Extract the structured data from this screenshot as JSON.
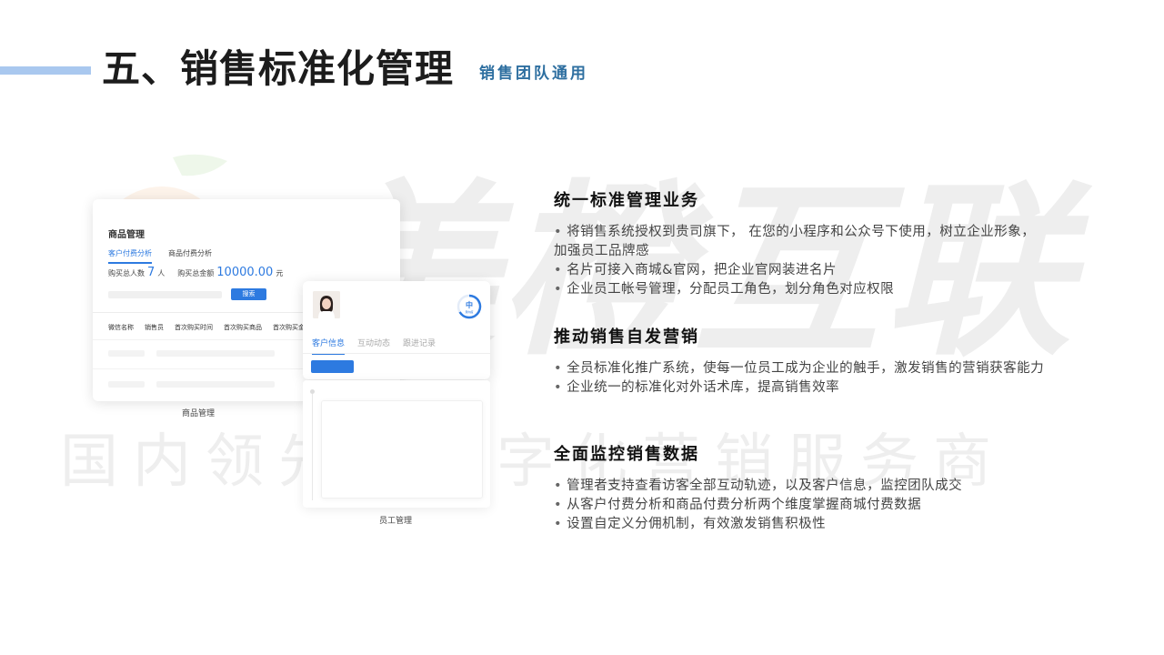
{
  "header": {
    "title": "五、销售标准化管理",
    "subtitle": "销售团队通用"
  },
  "watermark": {
    "brand": "美橙互联",
    "slogan": "国内领先的数字化营销服务商"
  },
  "card1": {
    "title": "商品管理",
    "tabs": [
      "客户付费分析",
      "商品付费分析"
    ],
    "stats": {
      "buyers_label": "购买总人数",
      "buyers_value": "7",
      "buyers_unit": "人",
      "amount_label": "购买总金额",
      "amount_value": "10000.00",
      "amount_unit": "元"
    },
    "search_label": "搜索",
    "columns": [
      "微信名称",
      "销售员",
      "首次购买时间",
      "首次购买商品",
      "首次购买金"
    ],
    "caption": "商品管理"
  },
  "card2": {
    "level_label": "中",
    "level_sublabel": "意向度",
    "tabs": [
      "客户信息",
      "互动动态",
      "跟进记录"
    ],
    "caption": "员工管理"
  },
  "sections": [
    {
      "title": "统一标准管理业务",
      "items": [
        "将销售系统授权到贵司旗下， 在您的小程序和公众号下使用，树立企业形象，加强员工品牌感",
        "名片可接入商城&官网，把企业官网装进名片",
        "企业员工帐号管理，分配员工角色，划分角色对应权限"
      ]
    },
    {
      "title": "推动销售自发营销",
      "items": [
        "全员标准化推广系统，使每一位员工成为企业的触手，激发销售的营销获客能力",
        "企业统一的标准化对外话术库，提高销售效率"
      ]
    },
    {
      "title": "全面监控销售数据",
      "items": [
        "管理者支持查看访客全部互动轨迹，以及客户信息，监控团队成交",
        "从客户付费分析和商品付费分析两个维度掌握商城付费数据",
        "设置自定义分佣机制，有效激发销售积极性"
      ]
    }
  ],
  "colors": {
    "accent_blue": "#2d7ae0",
    "subtitle_blue": "#2e6fa0",
    "accent_bar": "#a9c8ef"
  }
}
